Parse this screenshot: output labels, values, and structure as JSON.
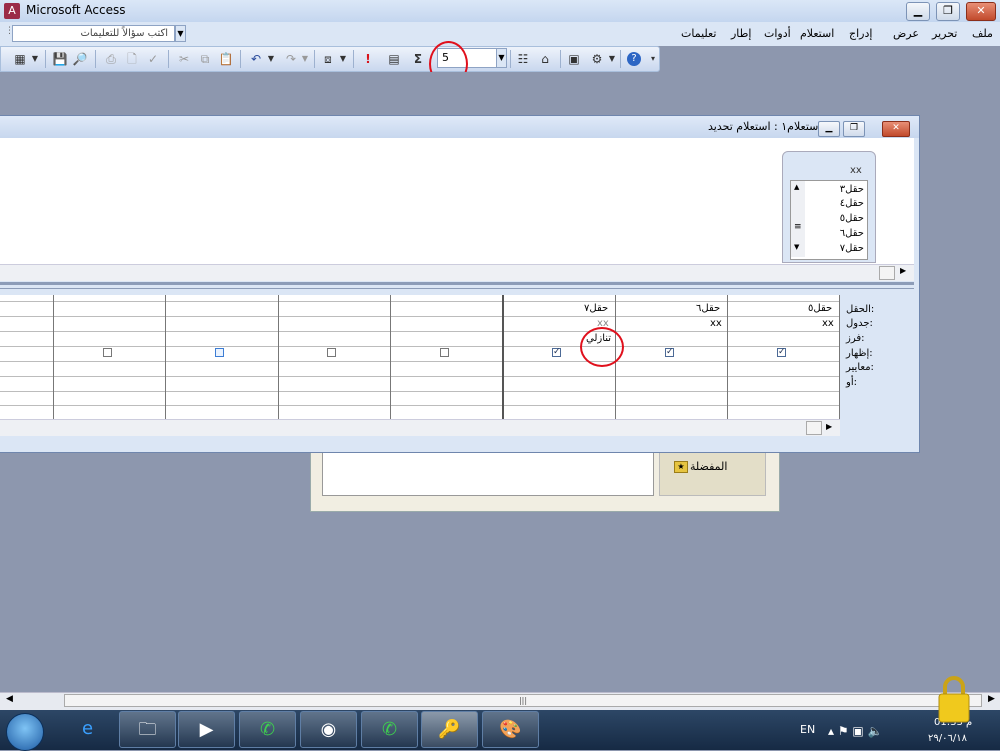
{
  "window": {
    "title": "Microsoft Access",
    "app_icon": "access-icon"
  },
  "menubar": {
    "help_placeholder": "اكتب سؤالاً للتعليمات",
    "items": [
      "ملف",
      "تحرير",
      "عرض",
      "إدراج",
      "استعلام",
      "أدوات",
      "إطار",
      "تعليمات"
    ]
  },
  "toolbar": {
    "top_values": "5"
  },
  "query_window": {
    "title": "استعلام١ : استعلام تحديد",
    "table": {
      "name": "xx",
      "fields": [
        "حقل٣",
        "حقل٤",
        "حقل٥",
        "حقل٦",
        "حقل٧"
      ]
    },
    "row_labels": [
      "الحقل:",
      "جدول:",
      "فرز:",
      "إظهار:",
      "معايير:",
      "أو:"
    ],
    "columns": [
      {
        "field": "حقل٥",
        "table": "xx",
        "sort": "",
        "show": true
      },
      {
        "field": "حقل٦",
        "table": "xx",
        "sort": "",
        "show": true
      },
      {
        "field": "حقل٧",
        "table": "xx",
        "sort": "تنازلي",
        "show": true
      },
      {
        "field": "",
        "table": "",
        "sort": "",
        "show": false
      },
      {
        "field": "",
        "table": "",
        "sort": "",
        "show": false
      },
      {
        "field": "",
        "table": "",
        "sort": "",
        "show": false
      },
      {
        "field": "",
        "table": "",
        "sort": "",
        "show": false
      }
    ]
  },
  "background_form": {
    "favorites_label": "المفضلة"
  },
  "taskbar": {
    "language": "EN",
    "clock_time": "01:33 م",
    "clock_date": "٢٩/٠٦/١٨"
  }
}
